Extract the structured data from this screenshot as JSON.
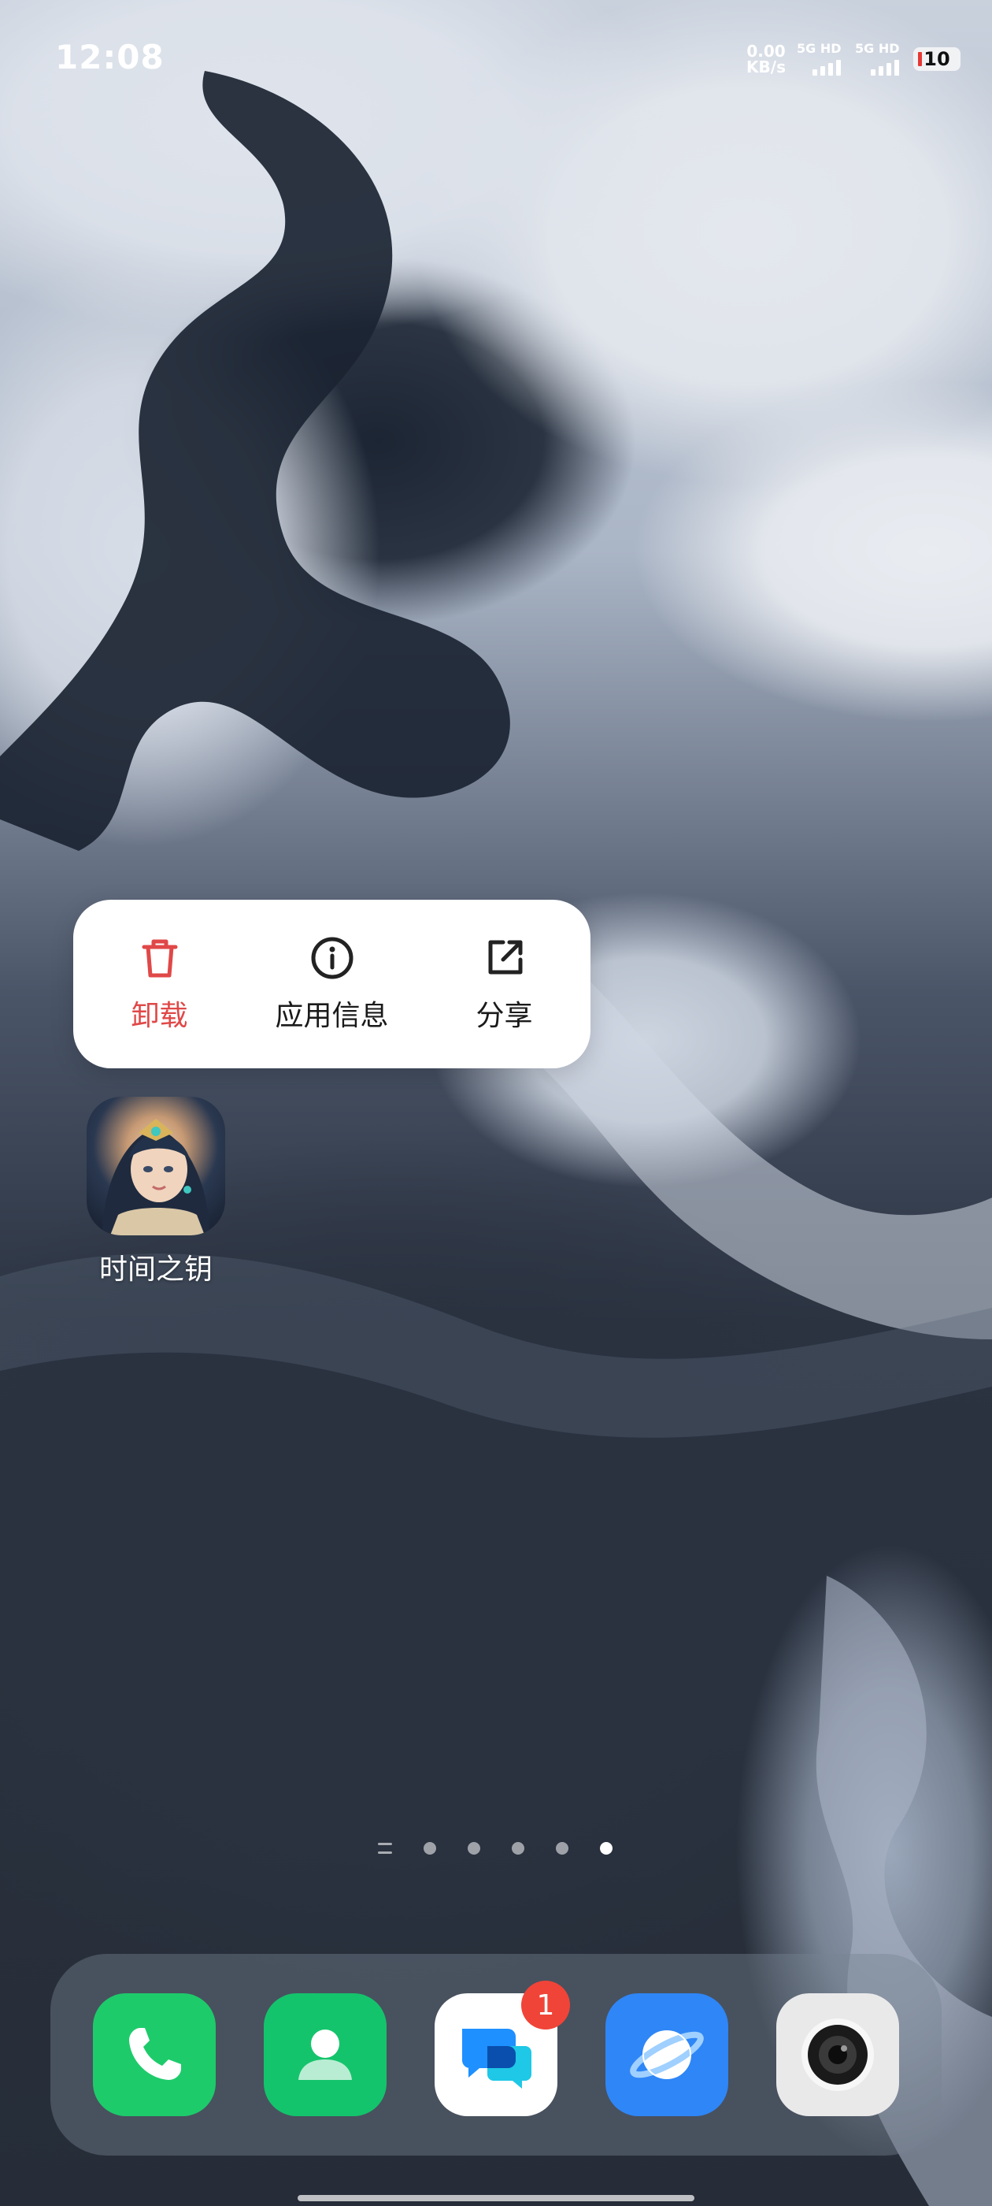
{
  "status_bar": {
    "time": "12:08",
    "net_speed_value": "0.00",
    "net_speed_unit": "KB/s",
    "sim1_label": "5G HD",
    "sim2_label": "5G HD",
    "battery_level": "10"
  },
  "popup_menu": {
    "items": [
      {
        "label": "卸载",
        "icon": "trash-icon",
        "color": "#e04848"
      },
      {
        "label": "应用信息",
        "icon": "info-icon"
      },
      {
        "label": "分享",
        "icon": "share-icon"
      }
    ]
  },
  "home_app": {
    "label": "时间之钥",
    "icon": "game-avatar-icon"
  },
  "page_indicator": {
    "pages": 5,
    "active_page": 5
  },
  "dock": {
    "apps": [
      {
        "name": "phone",
        "icon": "phone-icon",
        "color": "#1ecb6b"
      },
      {
        "name": "contacts",
        "icon": "contacts-icon",
        "color": "#14c46c"
      },
      {
        "name": "messages",
        "icon": "messages-icon",
        "badge": "1",
        "color": "#ffffff"
      },
      {
        "name": "browser",
        "icon": "browser-icon",
        "color": "#2f86f6"
      },
      {
        "name": "camera",
        "icon": "camera-icon",
        "color": "#e9e9ea"
      }
    ]
  }
}
